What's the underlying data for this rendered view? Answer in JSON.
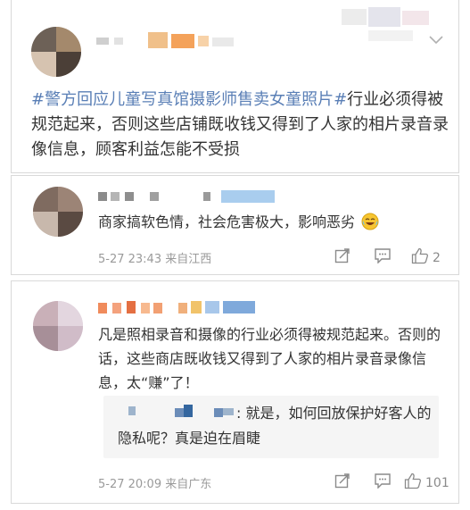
{
  "post": {
    "hashtag": "#警方回应儿童写真馆摄影师售卖女童照片#",
    "text": "行业必须得被规范起来，否则这些店铺既收钱又得到了人家的相片录音录像信息，顾客利益怎能不受损",
    "menu_icon": "chevron-down-icon"
  },
  "comments": [
    {
      "text": "商家搞软色情，社会危害极大，影响恶劣",
      "emoji": "laugh-cry-emoji",
      "meta": "5-27 23:43 来自江西",
      "likes": "2"
    },
    {
      "text": "凡是照相录音和摄像的行业必须得被规范起来。否则的话，这些商店既收钱又得到了人家的相片录音录像信息，太“赚”了！",
      "reply": ": 就是，如何回放保护好客人的隐私呢？真是迫在眉睫",
      "meta": "5-27 20:09 来自广东",
      "likes": "101"
    }
  ],
  "colors": {
    "hashtag": "#5a7fb6",
    "meta": "#9a9a9a",
    "border": "#d9d9d9",
    "quote_bg": "#f5f5f5"
  }
}
